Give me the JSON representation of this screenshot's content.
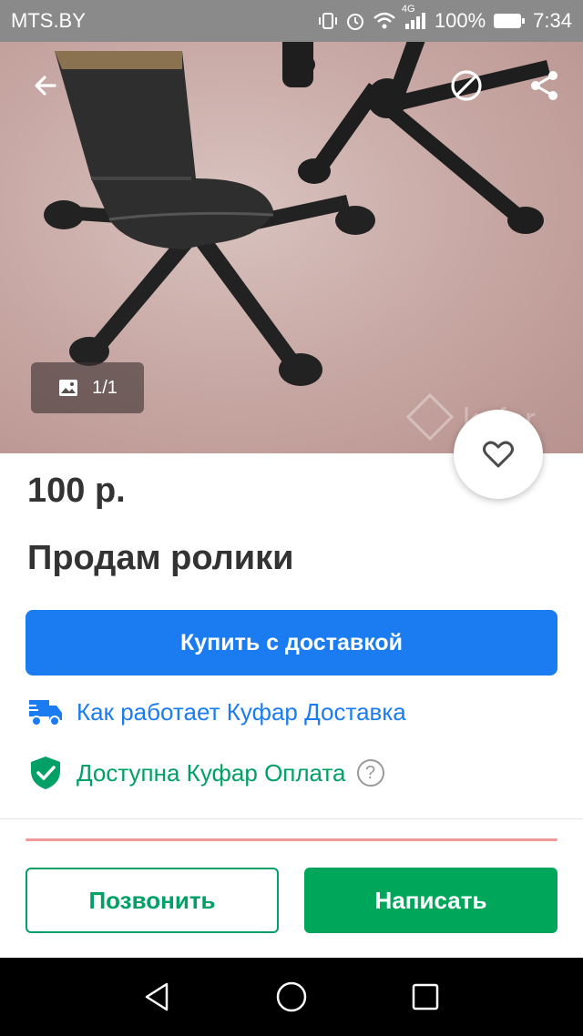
{
  "status_bar": {
    "carrier": "MTS.BY",
    "network": "4G",
    "battery": "100%",
    "time": "7:34"
  },
  "photo": {
    "counter": "1/1",
    "watermark": "kufar",
    "icons": [
      "back-arrow-icon",
      "block-icon",
      "share-icon",
      "image-icon"
    ]
  },
  "listing": {
    "price": "100 р.",
    "title": "Продам ролики"
  },
  "actions": {
    "buy_label": "Купить с доставкой",
    "delivery_link": "Как работает Куфар Доставка",
    "payment_text": "Доступна Куфар Оплата",
    "help_glyph": "?"
  },
  "footer": {
    "call_label": "Позвонить",
    "write_label": "Написать"
  },
  "colors": {
    "accent_blue": "#1a7cf0",
    "accent_green": "#00a66a",
    "status_bar": "#8a8a8a",
    "nav_bar": "#000000"
  }
}
